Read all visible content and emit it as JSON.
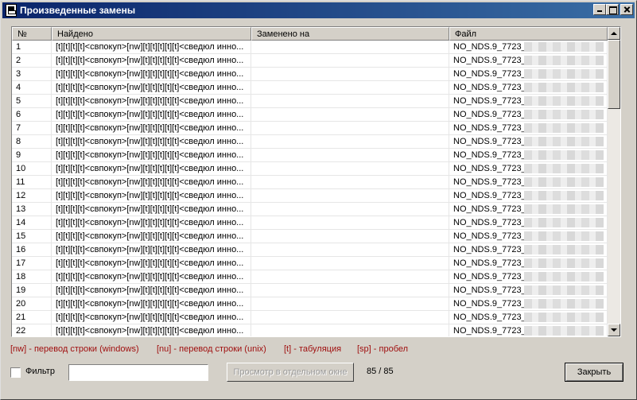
{
  "window": {
    "title": "Произведенные замены"
  },
  "table": {
    "headers": [
      "№",
      "Найдено",
      "Заменено на",
      "Файл"
    ],
    "rows": [
      {
        "num": "1",
        "found": "[t][t][t][t]<свпокуп>[nw][t][t][t][t][t]<сведюл инно...",
        "replaced": "",
        "file": "NO_NDS.9_7723_"
      },
      {
        "num": "2",
        "found": "[t][t][t][t]<свпокуп>[nw][t][t][t][t][t]<сведюл инно...",
        "replaced": "",
        "file": "NO_NDS.9_7723_"
      },
      {
        "num": "3",
        "found": "[t][t][t][t]<свпокуп>[nw][t][t][t][t][t]<сведюл инно...",
        "replaced": "",
        "file": "NO_NDS.9_7723_"
      },
      {
        "num": "4",
        "found": "[t][t][t][t]<свпокуп>[nw][t][t][t][t][t]<сведюл инно...",
        "replaced": "",
        "file": "NO_NDS.9_7723_"
      },
      {
        "num": "5",
        "found": "[t][t][t][t]<свпокуп>[nw][t][t][t][t][t]<сведюл инно...",
        "replaced": "",
        "file": "NO_NDS.9_7723_"
      },
      {
        "num": "6",
        "found": "[t][t][t][t]<свпокуп>[nw][t][t][t][t][t]<сведюл инно...",
        "replaced": "",
        "file": "NO_NDS.9_7723_"
      },
      {
        "num": "7",
        "found": "[t][t][t][t]<свпокуп>[nw][t][t][t][t][t]<сведюл инно...",
        "replaced": "",
        "file": "NO_NDS.9_7723_"
      },
      {
        "num": "8",
        "found": "[t][t][t][t]<свпокуп>[nw][t][t][t][t][t]<сведюл инно...",
        "replaced": "",
        "file": "NO_NDS.9_7723_"
      },
      {
        "num": "9",
        "found": "[t][t][t][t]<свпокуп>[nw][t][t][t][t][t]<сведюл инно...",
        "replaced": "",
        "file": "NO_NDS.9_7723_"
      },
      {
        "num": "10",
        "found": "[t][t][t][t]<свпокуп>[nw][t][t][t][t][t]<сведюл инно...",
        "replaced": "",
        "file": "NO_NDS.9_7723_"
      },
      {
        "num": "11",
        "found": "[t][t][t][t]<свпокуп>[nw][t][t][t][t][t]<сведюл инно...",
        "replaced": "",
        "file": "NO_NDS.9_7723_"
      },
      {
        "num": "12",
        "found": "[t][t][t][t]<свпокуп>[nw][t][t][t][t][t]<сведюл инно...",
        "replaced": "",
        "file": "NO_NDS.9_7723_"
      },
      {
        "num": "13",
        "found": "[t][t][t][t]<свпокуп>[nw][t][t][t][t][t]<сведюл инно...",
        "replaced": "",
        "file": "NO_NDS.9_7723_"
      },
      {
        "num": "14",
        "found": "[t][t][t][t]<свпокуп>[nw][t][t][t][t][t]<сведюл инно...",
        "replaced": "",
        "file": "NO_NDS.9_7723_"
      },
      {
        "num": "15",
        "found": "[t][t][t][t]<свпокуп>[nw][t][t][t][t][t]<сведюл инно...",
        "replaced": "",
        "file": "NO_NDS.9_7723_"
      },
      {
        "num": "16",
        "found": "[t][t][t][t]<свпокуп>[nw][t][t][t][t][t]<сведюл инно...",
        "replaced": "",
        "file": "NO_NDS.9_7723_"
      },
      {
        "num": "17",
        "found": "[t][t][t][t]<свпокуп>[nw][t][t][t][t][t]<сведюл инно...",
        "replaced": "",
        "file": "NO_NDS.9_7723_"
      },
      {
        "num": "18",
        "found": "[t][t][t][t]<свпокуп>[nw][t][t][t][t][t]<сведюл инно...",
        "replaced": "",
        "file": "NO_NDS.9_7723_"
      },
      {
        "num": "19",
        "found": "[t][t][t][t]<свпокуп>[nw][t][t][t][t][t]<сведюл инно...",
        "replaced": "",
        "file": "NO_NDS.9_7723_"
      },
      {
        "num": "20",
        "found": "[t][t][t][t]<свпокуп>[nw][t][t][t][t][t]<сведюл инно...",
        "replaced": "",
        "file": "NO_NDS.9_7723_"
      },
      {
        "num": "21",
        "found": "[t][t][t][t]<свпокуп>[nw][t][t][t][t][t]<сведюл инно...",
        "replaced": "",
        "file": "NO_NDS.9_7723_"
      },
      {
        "num": "22",
        "found": "[t][t][t][t]<свпокуп>[nw][t][t][t][t][t]<сведюл инно...",
        "replaced": "",
        "file": "NO_NDS.9_7723_"
      }
    ]
  },
  "legend": {
    "nw": "[nw] - перевод строки (windows)",
    "nu": "[nu] - перевод строки (unix)",
    "t": "[t] - табуляция",
    "sp": "[sp] - пробел"
  },
  "filter": {
    "checkbox_label": "Фильтр",
    "checked": false,
    "value": "",
    "placeholder": ""
  },
  "buttons": {
    "view_separate": "Просмотр в отдельном окне",
    "close": "Закрыть"
  },
  "counter": "85 / 85",
  "colors": {
    "legend_text": "#a01010",
    "title_bar": "#0a246a",
    "window_bg": "#d4d0c8"
  }
}
